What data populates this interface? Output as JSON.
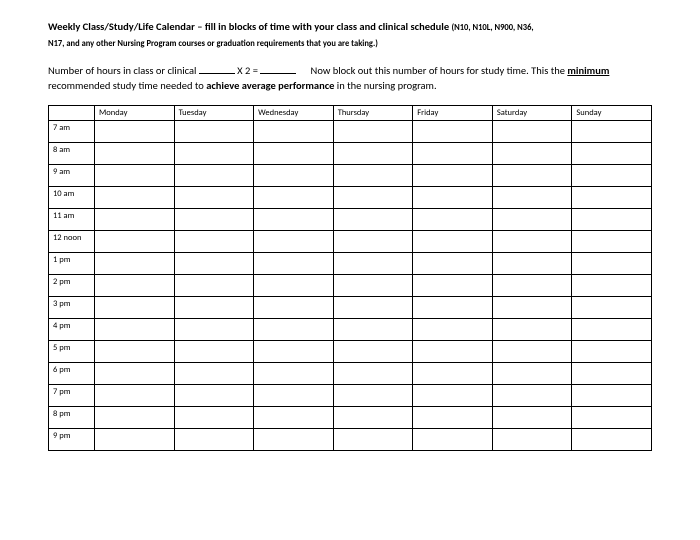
{
  "header": {
    "title_bold": "Weekly Class/Study/Life Calendar – fill in blocks of time with your class and clinical schedule",
    "title_note": "(N10, N10L, N900, N36,",
    "subtitle": "N17, and any other Nursing Program courses or graduation requirements that you are taking.)"
  },
  "instruction": {
    "pre_blank": "Number of hours in class or clinical ",
    "multiplier": " X 2 = ",
    "post_blank": " Now block out this number of hours for study time.  This the ",
    "minimum_word": "minimum",
    "middle": " recommended study time needed to ",
    "achieve_phrase": "achieve average performance",
    "tail": " in the nursing program."
  },
  "schedule": {
    "days": [
      "Monday",
      "Tuesday",
      "Wednesday",
      "Thursday",
      "Friday",
      "Saturday",
      "Sunday"
    ],
    "times": [
      "7 am",
      "8 am",
      "9 am",
      "10 am",
      "11 am",
      "12 noon",
      "1 pm",
      "2 pm",
      "3 pm",
      "4 pm",
      "5 pm",
      "6 pm",
      "7 pm",
      "8 pm",
      "9 pm"
    ]
  }
}
